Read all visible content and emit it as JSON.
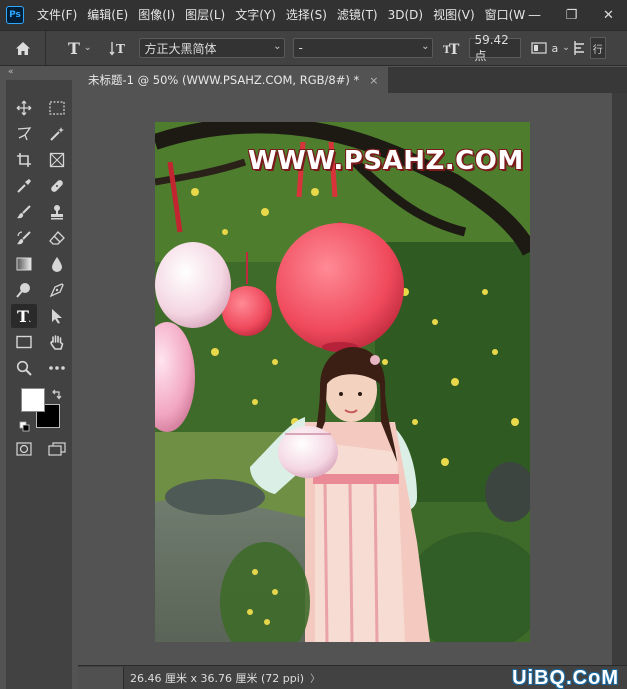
{
  "app": {
    "logo_text": "Ps"
  },
  "menu": [
    "文件(F)",
    "编辑(E)",
    "图像(I)",
    "图层(L)",
    "文字(Y)",
    "选择(S)",
    "滤镜(T)",
    "3D(D)",
    "视图(V)",
    "窗口(W"
  ],
  "window_controls": {
    "minimize": "—",
    "restore": "❐",
    "close": "✕"
  },
  "options": {
    "font_family": "方正大黑简体",
    "font_style": "-",
    "font_size": "59.42 点",
    "aa_label": "a",
    "overflow_char": "行"
  },
  "toolbar": {
    "collapse_glyph": "«"
  },
  "document": {
    "tab_title": "未标题-1 @ 50% (WWW.PSAHZ.COM, RGB/8#) *",
    "tab_close": "×",
    "watermark_text": "WWW.PSAHZ.COM"
  },
  "status": {
    "dimensions": "26.46 厘米 x 36.76 厘米 (72 ppi)",
    "arrow": "〉",
    "site_watermark": "UiBQ.CoM"
  },
  "colors": {
    "foreground": "#ffffff",
    "background": "#000000",
    "accent": "#31a8ff"
  }
}
